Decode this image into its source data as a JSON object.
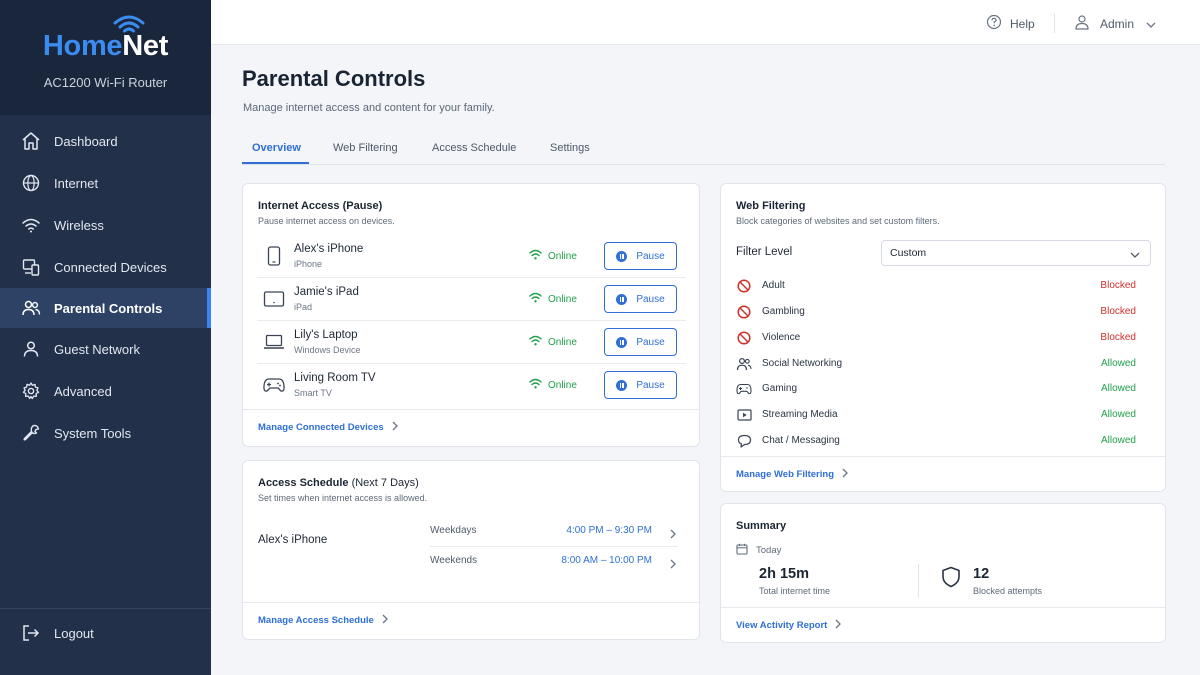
{
  "brand": {
    "name_part1": "Home",
    "name_part2": "Net",
    "model": "AC1200 Wi-Fi Router"
  },
  "sidebar": {
    "items": [
      {
        "label": "Dashboard",
        "icon": "home-icon"
      },
      {
        "label": "Internet",
        "icon": "globe-icon"
      },
      {
        "label": "Wireless",
        "icon": "wifi-icon"
      },
      {
        "label": "Connected Devices",
        "icon": "devices-icon"
      },
      {
        "label": "Parental Controls",
        "icon": "users-icon",
        "active": true
      },
      {
        "label": "Guest Network",
        "icon": "user-icon"
      },
      {
        "label": "Advanced",
        "icon": "gear-icon"
      },
      {
        "label": "System Tools",
        "icon": "wrench-icon"
      }
    ],
    "logout": "Logout"
  },
  "topbar": {
    "help": "Help",
    "user": "Admin"
  },
  "page": {
    "title": "Parental Controls",
    "subtitle": "Manage internet access and content for your family."
  },
  "tabs": [
    "Overview",
    "Web Filtering",
    "Access Schedule",
    "Settings"
  ],
  "internet_access": {
    "title": "Internet Access (Pause)",
    "subtitle": "Pause internet access on devices.",
    "devices": [
      {
        "name": "Alex's iPhone",
        "type": "iPhone",
        "status": "Online",
        "action": "Pause",
        "icon": "phone-icon"
      },
      {
        "name": "Jamie's iPad",
        "type": "iPad",
        "status": "Online",
        "action": "Pause",
        "icon": "tablet-icon"
      },
      {
        "name": "Lily's Laptop",
        "type": "Windows Device",
        "status": "Online",
        "action": "Pause",
        "icon": "laptop-icon"
      },
      {
        "name": "Living Room TV",
        "type": "Smart TV",
        "status": "Online",
        "action": "Pause",
        "icon": "gamepad-icon"
      }
    ],
    "footer_link": "Manage Connected Devices"
  },
  "access_schedule": {
    "title": "Access Schedule",
    "title_note": "(Next 7 Days)",
    "subtitle": "Set times when internet access is allowed.",
    "device": "Alex's iPhone",
    "rows": [
      {
        "label": "Weekdays",
        "time": "4:00 PM – 9:30 PM"
      },
      {
        "label": "Weekends",
        "time": "8:00 AM – 10:00 PM"
      }
    ],
    "footer_link": "Manage Access Schedule"
  },
  "web_filtering": {
    "title": "Web Filtering",
    "subtitle": "Block categories of websites and set custom filters.",
    "filter_label": "Filter Level",
    "filter_value": "Custom",
    "categories": [
      {
        "name": "Adult",
        "status": "Blocked",
        "icon": "block-icon"
      },
      {
        "name": "Gambling",
        "status": "Blocked",
        "icon": "block-icon"
      },
      {
        "name": "Violence",
        "status": "Blocked",
        "icon": "block-icon"
      },
      {
        "name": "Social Networking",
        "status": "Allowed",
        "icon": "people-icon"
      },
      {
        "name": "Gaming",
        "status": "Allowed",
        "icon": "gamepad-icon"
      },
      {
        "name": "Streaming Media",
        "status": "Allowed",
        "icon": "play-icon"
      },
      {
        "name": "Chat / Messaging",
        "status": "Allowed",
        "icon": "chat-icon"
      }
    ],
    "footer_link": "Manage Web Filtering"
  },
  "summary": {
    "title": "Summary",
    "period": "Today",
    "internet_time": "2h 15m",
    "internet_time_label": "Total internet time",
    "blocked": "12",
    "blocked_label": "Blocked attempts",
    "footer_link": "View Activity Report"
  },
  "colors": {
    "accent": "#2f6fd6",
    "sidebar": "#22304a",
    "online": "#22a04b",
    "blocked": "#d0312d"
  }
}
